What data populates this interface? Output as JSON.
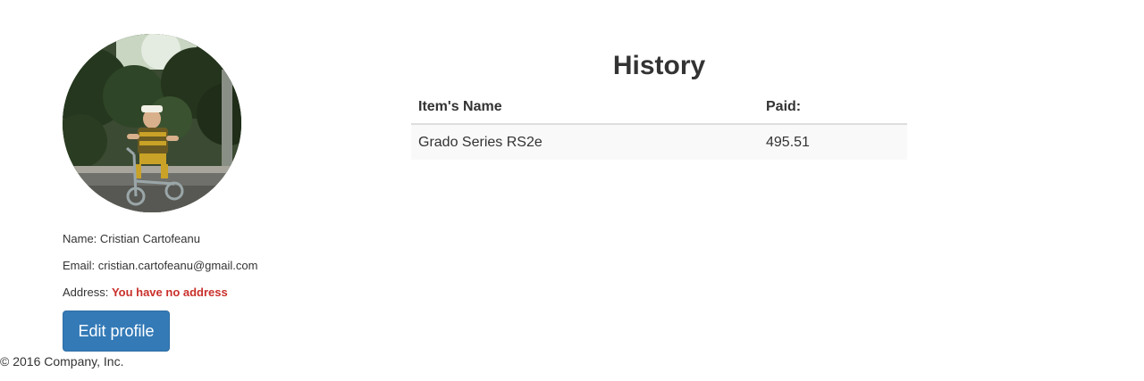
{
  "profile": {
    "avatar_alt": "Profile photo",
    "name_label": "Name:",
    "name_value": "Cristian Cartofeanu",
    "email_label": "Email:",
    "email_value": "cristian.cartofeanu@gmail.com",
    "address_label": "Address:",
    "address_value": "You have no address",
    "edit_button": "Edit profile"
  },
  "history": {
    "title": "History",
    "columns": [
      "Item's Name",
      "Paid:"
    ],
    "rows": [
      [
        "Grado Series RS2e",
        "495.51"
      ]
    ]
  },
  "footer": {
    "copyright": "© 2016 Company, Inc."
  },
  "colors": {
    "primary_button": "#337ab7",
    "warning_text": "#c9302c",
    "striped_row": "#f9f9f9"
  }
}
